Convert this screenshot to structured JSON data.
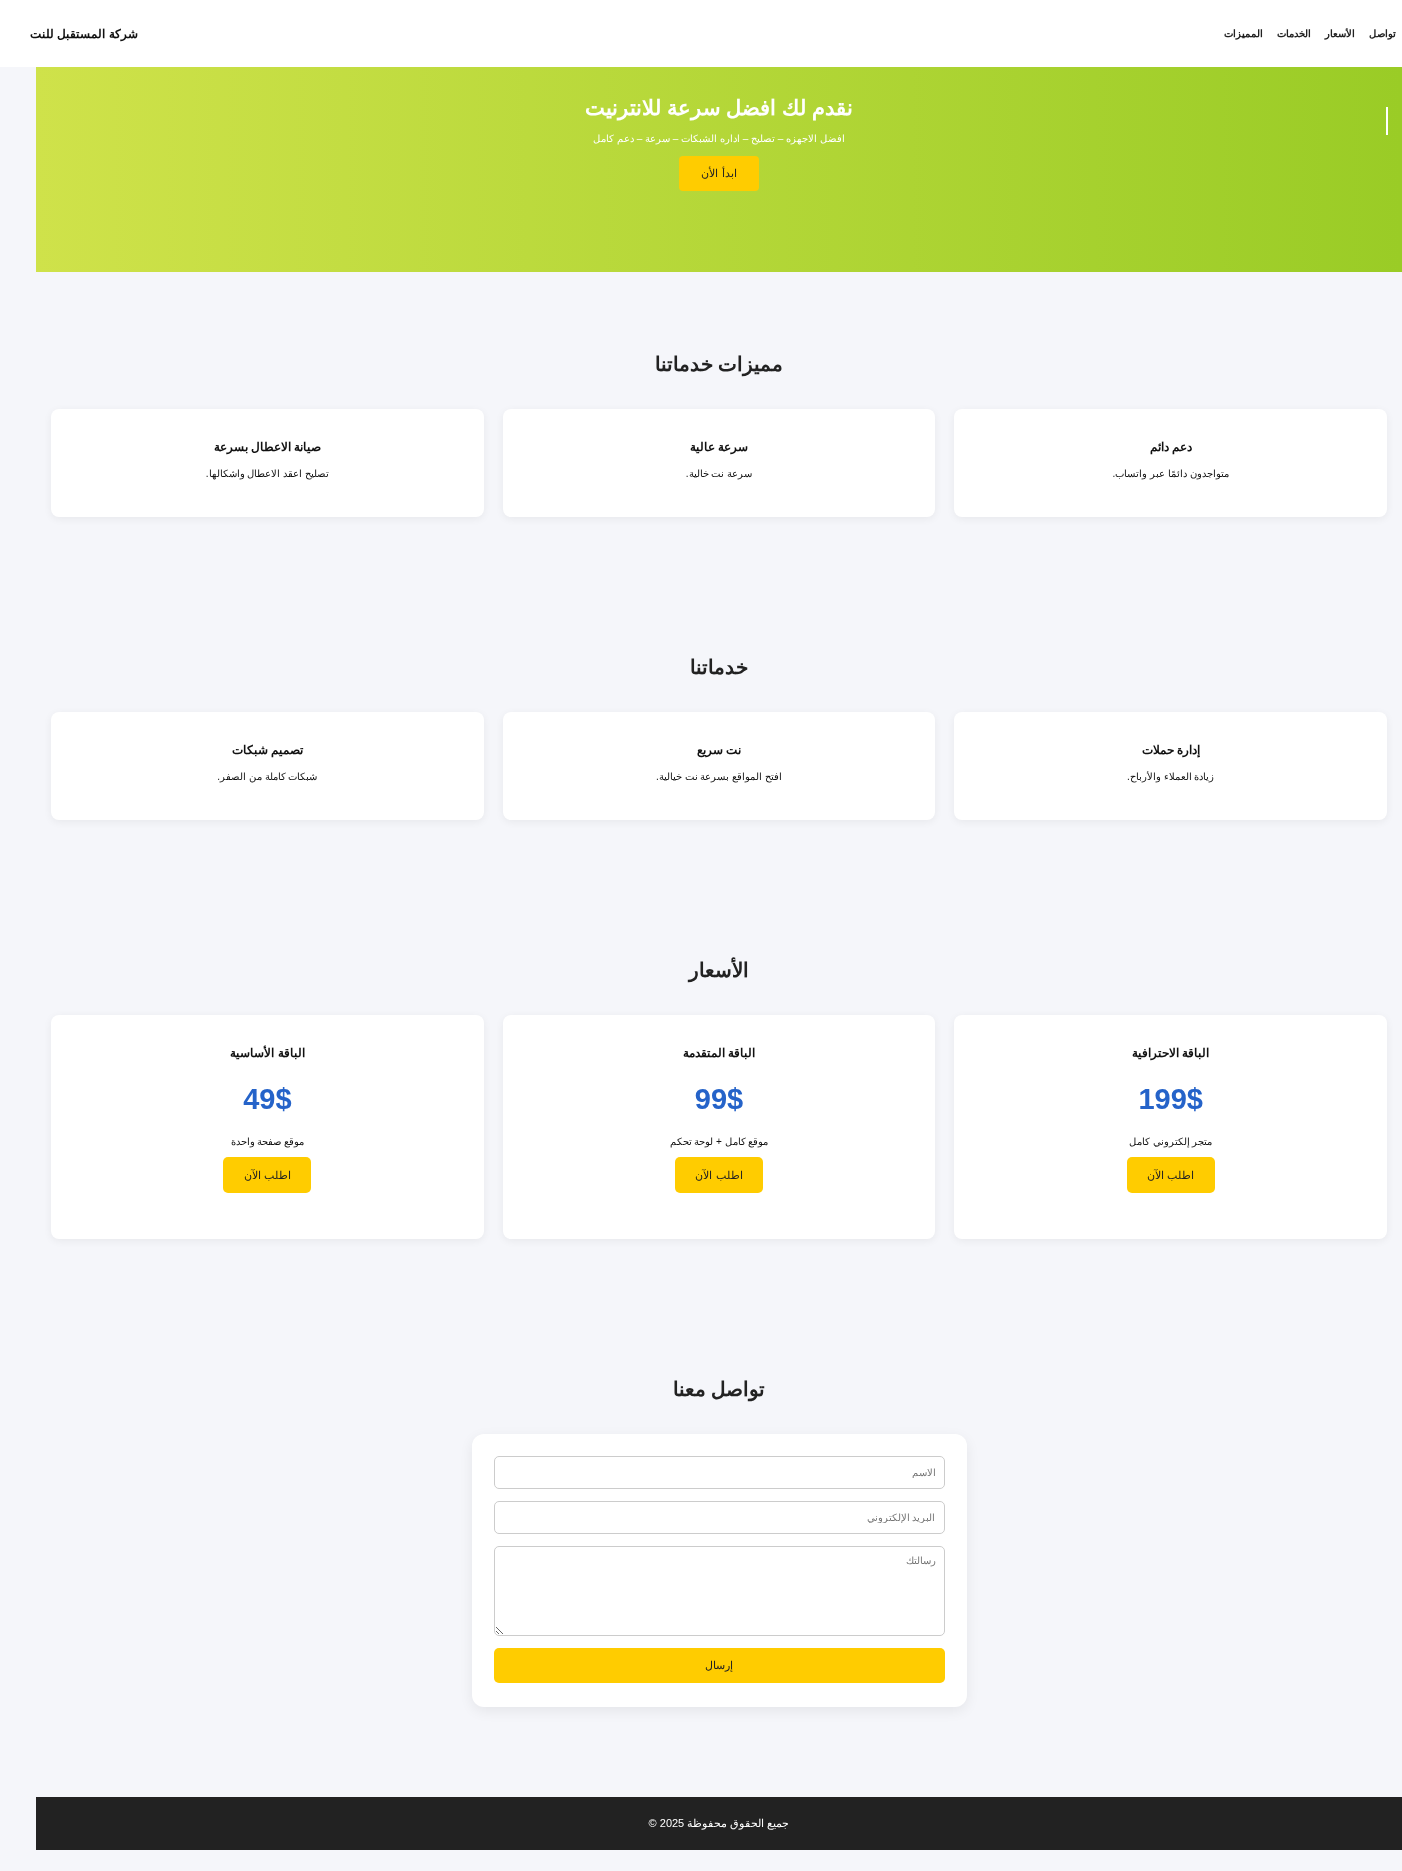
{
  "header": {
    "brand": "شركة المستقبل للنت",
    "nav": [
      {
        "label": "تواصل"
      },
      {
        "label": "الأسعار"
      },
      {
        "label": "الخدمات"
      },
      {
        "label": "المميزات"
      }
    ]
  },
  "hero": {
    "title": "نقدم لك افضل سرعة للانترنيت",
    "subtitle": "افضل الاجهزه – تصليح – اداره الشبكات – سرعة – دعم كامل",
    "button": "ابدأ الأن"
  },
  "features": {
    "title": "مميزات خدماتنا",
    "cards": [
      {
        "title": "دعم دائم",
        "text": "متواجدون دائمًا عبر واتساب."
      },
      {
        "title": "سرعة عالية",
        "text": "سرعة نت خالية."
      },
      {
        "title": "صيانة الاعطال بسرعة",
        "text": "تصليح اعقد الاعطال واشكالها."
      }
    ]
  },
  "services": {
    "title": "خدماتنا",
    "cards": [
      {
        "title": "إدارة حملات",
        "text": "زيادة العملاء والأرباح."
      },
      {
        "title": "نت سريع",
        "text": "افتح المواقع بسرعة نت خيالية."
      },
      {
        "title": "تصميم شبكات",
        "text": "شبكات كاملة من الصفر."
      }
    ]
  },
  "pricing": {
    "title": "الأسعار",
    "plans": [
      {
        "name": "الباقة الاحترافية",
        "price": "199$",
        "description": "متجر إلكتروني كامل",
        "button": "اطلب الآن"
      },
      {
        "name": "الباقة المتقدمة",
        "price": "99$",
        "description": "موقع كامل + لوحة تحكم",
        "button": "اطلب الآن"
      },
      {
        "name": "الباقة الأساسية",
        "price": "49$",
        "description": "موقع صفحة واحدة",
        "button": "اطلب الآن"
      }
    ]
  },
  "contact": {
    "title": "تواصل معنا",
    "fields": [
      {
        "kind": "input",
        "placeholder": "الاسم"
      },
      {
        "kind": "input",
        "placeholder": "البريد الإلكتروني"
      },
      {
        "kind": "textarea",
        "placeholder": "رسالتك"
      }
    ],
    "button": "إرسال"
  },
  "footer": {
    "text": "جميع الحقوق محفوظة 2025 ©"
  }
}
